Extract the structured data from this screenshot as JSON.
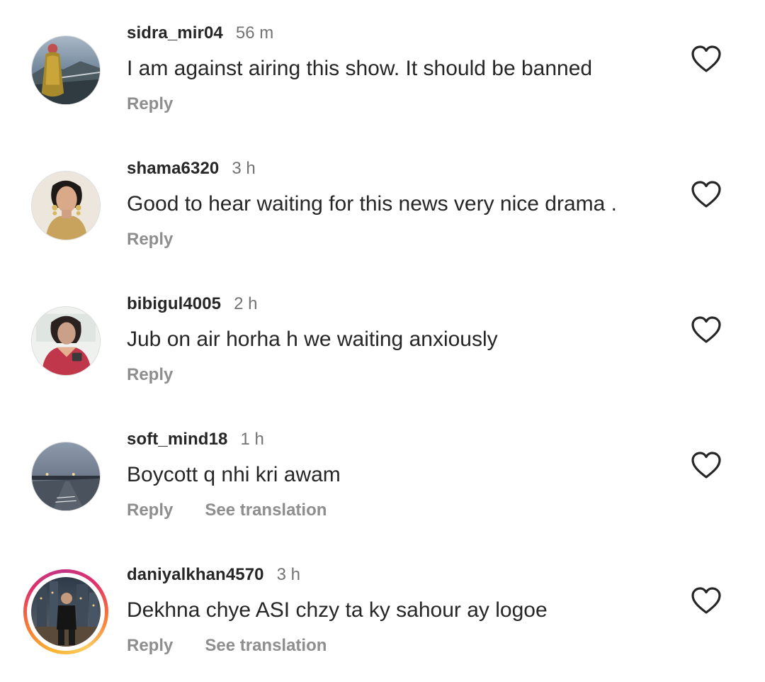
{
  "comments": [
    {
      "username": "sidra_mir04",
      "time": "56 m",
      "text": "I am against airing this show. It should be banned",
      "reply_label": "Reply",
      "translate_label": null,
      "avatar_icon": "avatar-photo-woman-mountains",
      "has_story_ring": false
    },
    {
      "username": "shama6320",
      "time": "3 h",
      "text": "Good to hear waiting for this news very nice drama .",
      "reply_label": "Reply",
      "translate_label": null,
      "avatar_icon": "avatar-photo-woman-earrings",
      "has_story_ring": false
    },
    {
      "username": "bibigul4005",
      "time": "2 h",
      "text": "Jub on air horha h we waiting anxiously",
      "reply_label": "Reply",
      "translate_label": null,
      "avatar_icon": "avatar-photo-woman-red-dress",
      "has_story_ring": false
    },
    {
      "username": "soft_mind18",
      "time": "1 h",
      "text": "Boycott q nhi kri awam",
      "reply_label": "Reply",
      "translate_label": "See translation",
      "avatar_icon": "avatar-photo-road-dusk",
      "has_story_ring": false
    },
    {
      "username": "daniyalkhan4570",
      "time": "3 h",
      "text": "Dekhna chye ASI chzy ta ky sahour ay logoe",
      "reply_label": "Reply",
      "translate_label": "See translation",
      "avatar_icon": "avatar-photo-man-city-night",
      "has_story_ring": true
    }
  ],
  "icons": {
    "like": "heart-outline-icon"
  },
  "colors": {
    "text_primary": "#262626",
    "text_secondary": "#737373",
    "action_text": "#8e8e8e",
    "story_ring_gradient": [
      "#f9b233",
      "#f77737",
      "#e1306c",
      "#c13584"
    ]
  }
}
